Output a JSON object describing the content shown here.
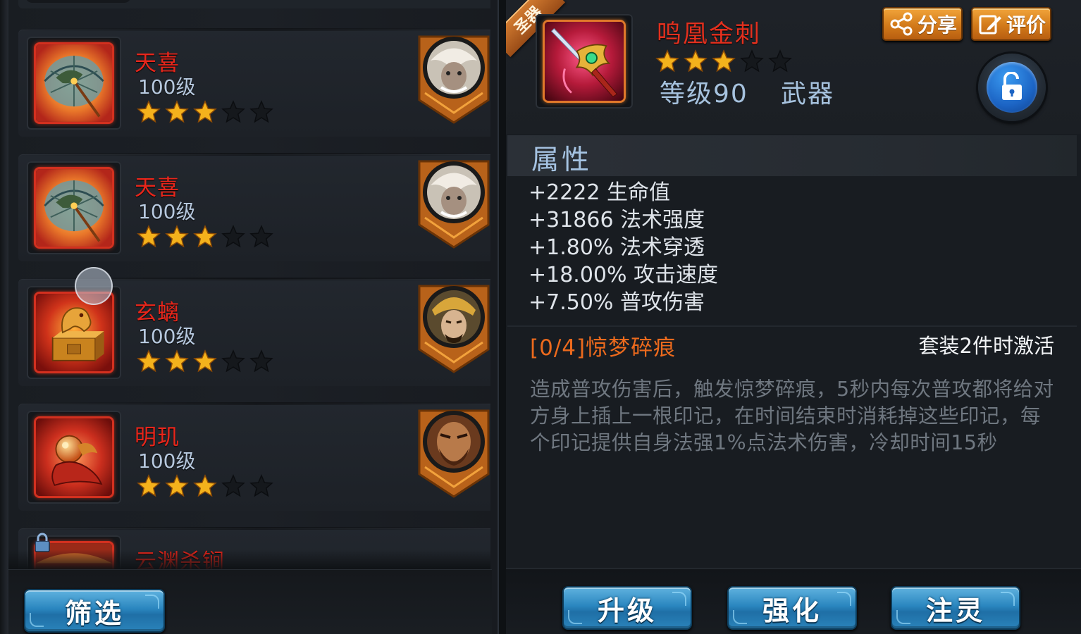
{
  "inventory": {
    "items": [
      {
        "name": "天喜",
        "level": "100级",
        "stars": 3,
        "max_stars": 5,
        "icon": "parasol-weapon-icon",
        "owner": "white-beast-hero-avatar"
      },
      {
        "name": "天喜",
        "level": "100级",
        "stars": 3,
        "max_stars": 5,
        "icon": "parasol-weapon-icon",
        "owner": "white-beast-hero-avatar"
      },
      {
        "name": "玄螭",
        "level": "100级",
        "stars": 3,
        "max_stars": 5,
        "icon": "dragon-seal-icon",
        "owner": "golden-helmet-hero-avatar"
      },
      {
        "name": "明玑",
        "level": "100级",
        "stars": 3,
        "max_stars": 5,
        "icon": "golden-orb-icon",
        "owner": "bearded-warrior-hero-avatar"
      },
      {
        "name": "云渊杀锏",
        "locked": true,
        "icon": "mace-weapon-icon"
      }
    ],
    "filter_label": "筛选"
  },
  "detail": {
    "rarity_ribbon": "圣器",
    "name": "鸣凰金刺",
    "stars": 3,
    "max_stars": 5,
    "level": "等级90",
    "type": "武器",
    "share_label": "分享",
    "review_label": "评价",
    "lock_state": "unlocked",
    "attributes_title": "属性",
    "attributes": [
      "+2222 生命值",
      "+31866 法术强度",
      "+1.80% 法术穿透",
      "+18.00% 攻击速度",
      "+7.50% 普攻伤害"
    ],
    "set_title": "[0/4]惊梦碎痕",
    "set_activation": "套装2件时激活",
    "set_description": "造成普攻伤害后，触发惊梦碎痕，5秒内每次普攻都将给对方身上插上一根印记，在时间结束时消耗掉这些印记，每个印记提供自身法强1%点法术伤害，冷却时间15秒"
  },
  "actions": {
    "upgrade_label": "升级",
    "enhance_label": "强化",
    "infuse_label": "注灵"
  },
  "colors": {
    "item_name": "#e8261b",
    "set_title": "#ec6a1d",
    "star_filled": "#f4b21c",
    "button_blue": "#2a86bf",
    "button_orange": "#d27a1a"
  }
}
